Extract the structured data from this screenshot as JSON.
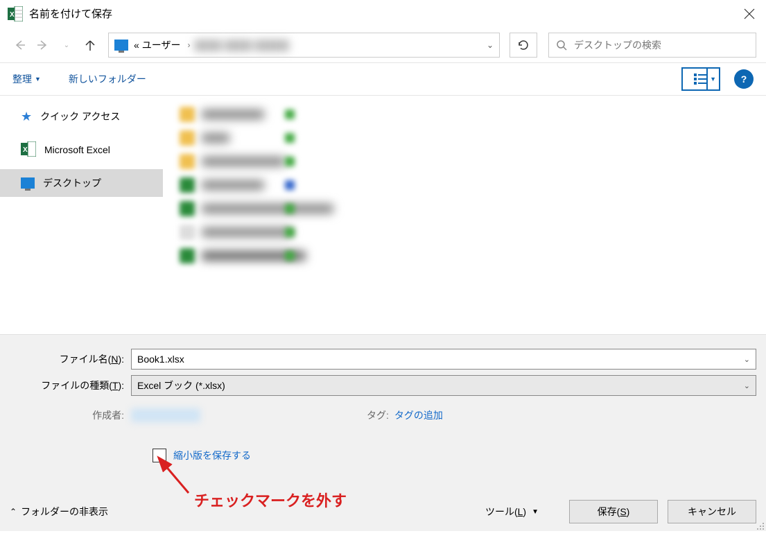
{
  "titlebar": {
    "title": "名前を付けて保存"
  },
  "nav": {
    "breadcrumb_prefix": "«",
    "breadcrumb_user": "ユーザー",
    "search_placeholder": "デスクトップの検索"
  },
  "toolbar": {
    "organize": "整理",
    "new_folder": "新しいフォルダー"
  },
  "sidebar": {
    "items": [
      {
        "label": "クイック アクセス"
      },
      {
        "label": "Microsoft Excel"
      },
      {
        "label": "デスクトップ"
      }
    ]
  },
  "fields": {
    "filename_label_pre": "ファイル名(",
    "filename_label_key": "N",
    "filename_label_post": "):",
    "filename_value": "Book1.xlsx",
    "filetype_label_pre": "ファイルの種類(",
    "filetype_label_key": "T",
    "filetype_label_post": "):",
    "filetype_value": "Excel ブック (*.xlsx)",
    "author_label": "作成者:",
    "tags_label": "タグ:",
    "tags_link": "タグの追加",
    "thumbnail_label": "縮小版を保存する"
  },
  "footer": {
    "hide_folders": "フォルダーの非表示",
    "tools_pre": "ツール(",
    "tools_key": "L",
    "tools_post": ")",
    "save_pre": "保存(",
    "save_key": "S",
    "save_post": ")",
    "cancel": "キャンセル"
  },
  "annotation": {
    "text": "チェックマークを外す"
  }
}
